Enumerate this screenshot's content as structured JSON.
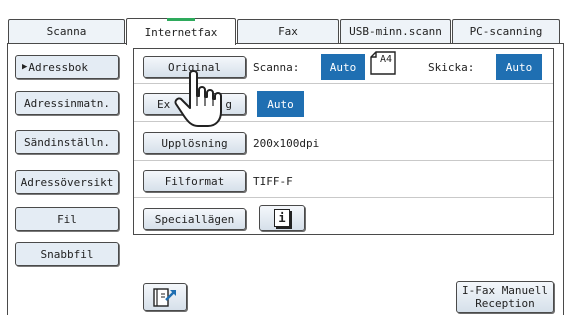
{
  "tabs": [
    {
      "label": "Scanna",
      "active": false
    },
    {
      "label": "Internetfax",
      "active": true
    },
    {
      "label": "Fax",
      "active": false
    },
    {
      "label": "USB-minn.scann",
      "active": false
    },
    {
      "label": "PC-scanning",
      "active": false
    }
  ],
  "sidebar": {
    "items": [
      {
        "label": "Adressbok",
        "selected": true
      },
      {
        "label": "Adressinmatn."
      },
      {
        "label": "Sändinställn."
      },
      {
        "label": "Adressöversikt"
      },
      {
        "label": "Fil"
      },
      {
        "label": "Snabbfil"
      }
    ]
  },
  "settings": {
    "original": {
      "label": "Original",
      "scan_label": "Scanna:",
      "scan_value": "Auto",
      "paper_size": "A4",
      "send_label": "Skicka:",
      "send_value": "Auto"
    },
    "exposure": {
      "label_left": "Ex",
      "label_right": "g",
      "value": "Auto"
    },
    "resolution": {
      "label": "Upplösning",
      "value": "200x100dpi"
    },
    "file_format": {
      "label": "Filformat",
      "value": "TIFF-F"
    },
    "special_modes": {
      "label": "Speciallägen",
      "info_icon": "info-icon"
    }
  },
  "bottom": {
    "address_icon": "address-book-icon",
    "ifax_manual_line1": "I-Fax Manuell",
    "ifax_manual_line2": "Reception"
  },
  "colors": {
    "accent_blue": "#1f6fb2",
    "active_tab_marker": "#2eaa5c",
    "button_face": "#e4ecf4"
  }
}
